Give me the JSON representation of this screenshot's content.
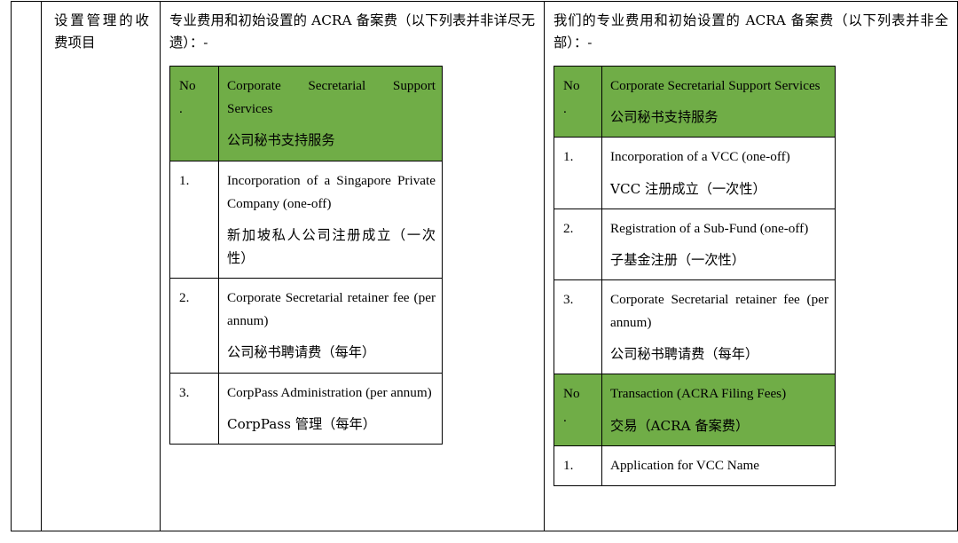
{
  "document": {
    "type": "bilingual-fee-schedule-table",
    "accent_green": "#70AD47",
    "border_color": "#000000",
    "text_color": "#000000"
  },
  "row_label": {
    "text": "设置管理的收费项目"
  },
  "columns": [
    {
      "id": "singapore-private-company",
      "intro": "专业费用和初始设置的 ACRA 备案费（以下列表并非详尽无遗）：-",
      "tables": [
        {
          "id": "corporate-secretarial-support-services",
          "header": {
            "no": "No.",
            "no_line1": "No",
            "no_line2": ".",
            "title_en": "Corporate Secretarial Support Services",
            "title_cn": "公司秘书支持服务"
          },
          "rows": [
            {
              "no": "1.",
              "en": "Incorporation of a Singapore Private Company (one-off)",
              "cn": "新加坡私人公司注册成立（一次性）"
            },
            {
              "no": "2.",
              "en": "Corporate Secretarial retainer fee (per annum)",
              "cn": "公司秘书聘请费（每年）"
            },
            {
              "no": "3.",
              "en": "CorpPass Administration (per annum)",
              "cn": "CorpPass 管理（每年）"
            }
          ]
        }
      ]
    },
    {
      "id": "vcc",
      "intro": "我们的专业费用和初始设置的 ACRA 备案费（以下列表并非全部）：-",
      "tables": [
        {
          "id": "corporate-secretarial-support-services-vcc",
          "header": {
            "no": "No.",
            "no_line1": "No",
            "no_line2": ".",
            "title_en": "Corporate Secretarial Support Services",
            "title_cn": "公司秘书支持服务"
          },
          "rows": [
            {
              "no": "1.",
              "en": "Incorporation of a VCC (one-off)",
              "cn": "VCC 注册成立（一次性）"
            },
            {
              "no": "2.",
              "en": "Registration of a Sub-Fund (one-off)",
              "cn": "子基金注册（一次性）"
            },
            {
              "no": "3.",
              "en": "Corporate Secretarial retainer fee (per annum)",
              "cn": "公司秘书聘请费（每年）"
            }
          ]
        },
        {
          "id": "transaction-acra-filing-fees",
          "header": {
            "no": "No.",
            "no_line1": "No",
            "no_line2": ".",
            "title_en": "Transaction (ACRA Filing Fees)",
            "title_cn": "交易（ACRA 备案费）"
          },
          "rows": [
            {
              "no": "1.",
              "en": "Application for VCC Name",
              "cn": ""
            }
          ]
        }
      ]
    }
  ]
}
